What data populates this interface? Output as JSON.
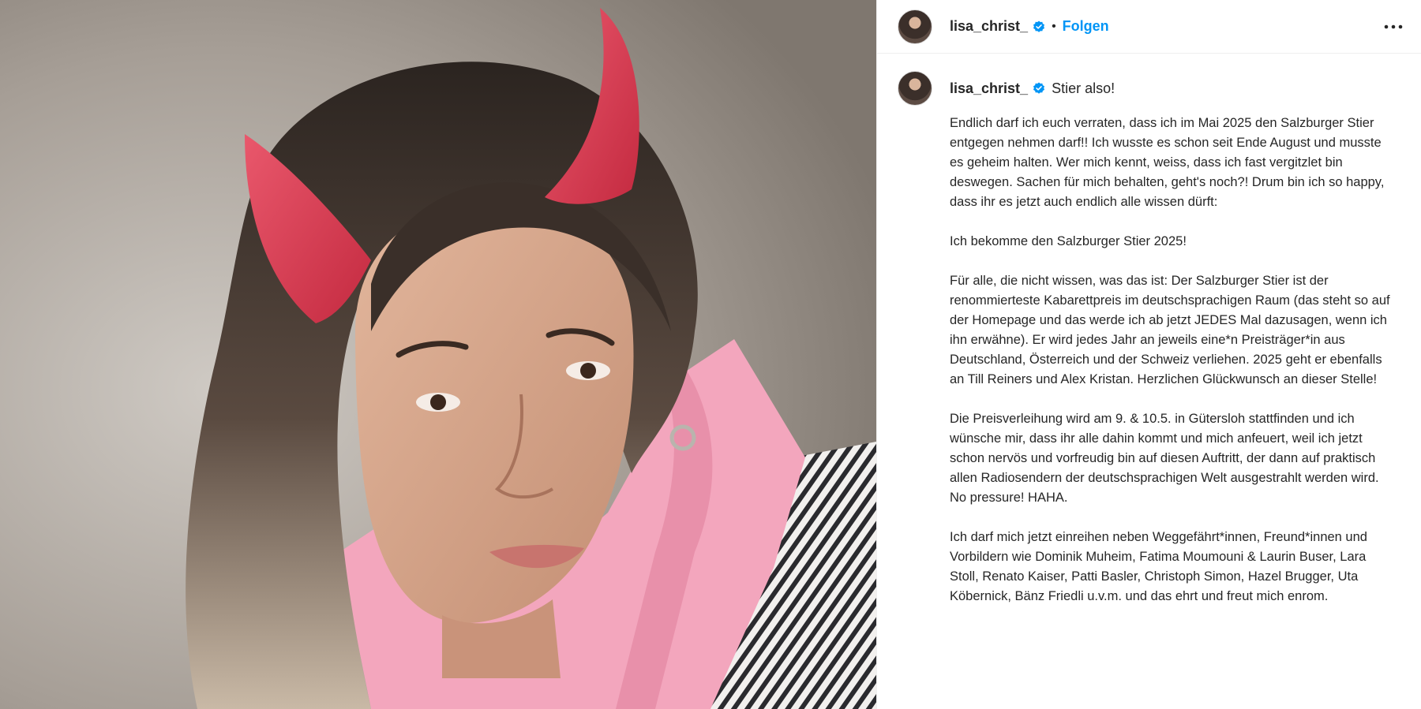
{
  "post": {
    "username": "lisa_christ_",
    "verified": true,
    "separator": "•",
    "follow_label": "Folgen",
    "more_icon": "more-horizontal-icon",
    "caption_title": "Stier also!",
    "caption_paragraphs": [
      "Endlich darf ich euch verraten, dass ich im Mai 2025 den Salzburger Stier entgegen nehmen darf!! Ich wusste es schon seit Ende August und musste es geheim halten. Wer mich kennt, weiss, dass ich fast vergitzlet bin deswegen. Sachen für mich behalten, geht's noch?! Drum bin ich so happy, dass ihr es jetzt auch endlich alle wissen dürft:",
      "Ich bekomme den Salzburger Stier 2025!",
      "Für alle, die nicht wissen, was das ist: Der Salzburger Stier ist der renommierteste Kabarettpreis im deutschsprachigen Raum (das steht so auf der Homepage und das werde ich ab jetzt JEDES Mal dazusagen, wenn ich ihn erwähne). Er wird jedes Jahr an jeweils eine*n Preisträger*in aus Deutschland, Österreich und der Schweiz verliehen. 2025 geht er ebenfalls an Till Reiners und Alex Kristan. Herzlichen Glückwunsch an dieser Stelle!",
      "Die Preisverleihung wird am 9. & 10.5. in Gütersloh stattfinden und ich wünsche mir, dass ihr alle dahin kommt und mich anfeuert, weil ich jetzt schon nervös und vorfreudig bin auf diesen Auftritt, der dann auf praktisch allen Radiosendern der deutschsprachigen Welt ausgestrahlt werden wird. No pressure! HAHA.",
      "Ich darf mich jetzt einreihen neben Weggefährt*innen, Freund*innen und Vorbildern wie Dominik Muheim, Fatima Moumouni & Laurin Buser, Lara Stoll, Renato Kaiser, Patti Basler, Christoph Simon, Hazel Brugger, Uta Köbernick, Bänz Friedli u.v.m. und das ehrt und freut mich enrom."
    ]
  },
  "colors": {
    "accent": "#0095f6",
    "verified": "#0095f6",
    "text": "#262626",
    "horn": "#d8394f",
    "hoodie": "#f3a6bd"
  }
}
